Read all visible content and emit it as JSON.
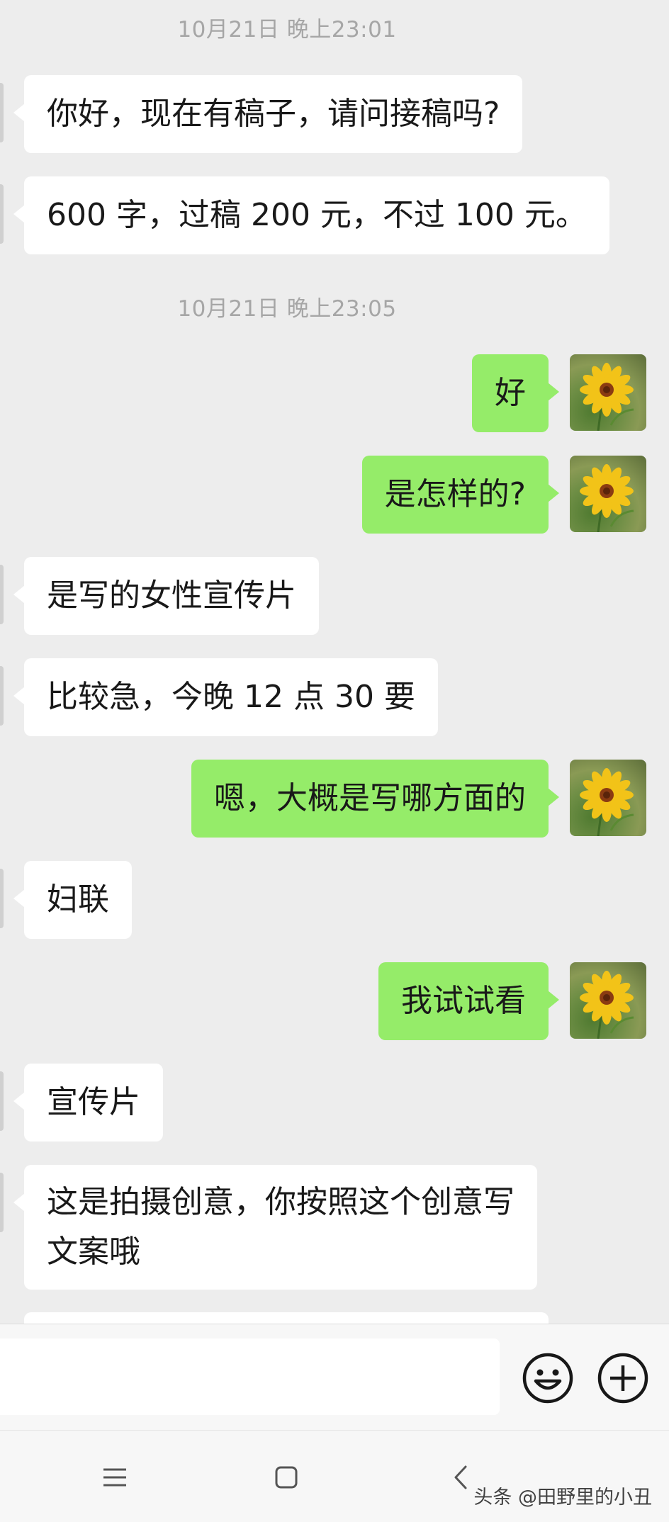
{
  "messages": [
    {
      "kind": "time",
      "text": "10月21日 晚上23:01"
    },
    {
      "kind": "in",
      "text": "你好，现在有稿子，请问接稿吗?"
    },
    {
      "kind": "in",
      "text": "600 字，过稿 200 元，不过 100 元。"
    },
    {
      "kind": "time",
      "text": "10月21日 晚上23:05"
    },
    {
      "kind": "out",
      "text": "好",
      "avatar": "sunflower-avatar"
    },
    {
      "kind": "out",
      "text": "是怎样的?",
      "avatar": "sunflower-avatar"
    },
    {
      "kind": "in",
      "text": "是写的女性宣传片"
    },
    {
      "kind": "in",
      "text": "比较急，今晚 12 点 30 要"
    },
    {
      "kind": "out",
      "text": "嗯，大概是写哪方面的",
      "avatar": "sunflower-avatar"
    },
    {
      "kind": "in",
      "text": "妇联"
    },
    {
      "kind": "out",
      "text": "我试试看",
      "avatar": "sunflower-avatar"
    },
    {
      "kind": "in",
      "text": "宣传片"
    },
    {
      "kind": "in",
      "lines": [
        "这是拍摄创意，你按照这个创意写",
        "文案哦"
      ]
    }
  ],
  "input_bar": {
    "text_value": "",
    "emoji_icon": "smiley-face-icon",
    "more_icon": "plus-circle-icon"
  },
  "nav_bar": {
    "menu_icon": "menu-lines-icon",
    "home_icon": "square-home-icon",
    "back_icon": "chevron-left-back-icon"
  },
  "watermark": "头条 @田野里的小丑",
  "colors": {
    "background": "#ededed",
    "incoming_bubble": "#ffffff",
    "outgoing_bubble": "#95ec69",
    "timestamp_text": "#a6a6a6",
    "message_text": "#191919"
  }
}
